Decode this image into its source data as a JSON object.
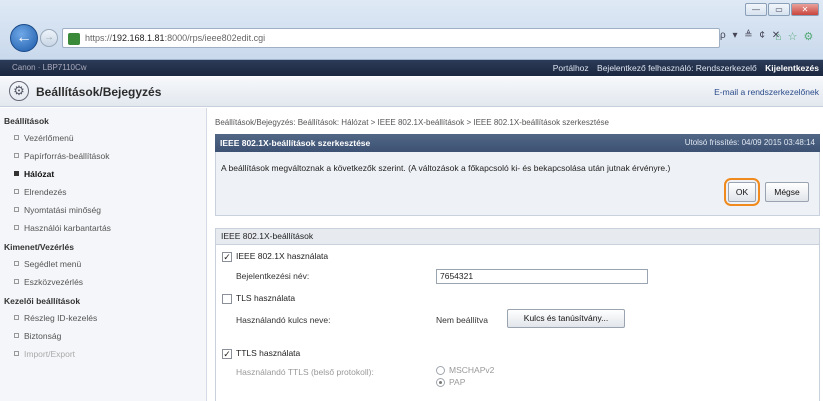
{
  "browser": {
    "url_prefix": "https://",
    "url_host": "192.168.1.81",
    "url_rest": ":8000/rps/ieee802edit.cgi",
    "search_tools": "ρ ▾ ≜ ¢ ✕",
    "window_minimize": "—",
    "window_maximize": "▭",
    "window_close": "✕"
  },
  "topbar": {
    "device_name": "Canon · LBP7110Cw",
    "links": [
      "Portálhoz",
      "Bejelentkező felhasználó: Rendszerkezelő"
    ],
    "logout": "Kijelentkezés"
  },
  "titlebar": {
    "title": "Beállítások/Bejegyzés",
    "mail_link": "E-mail a rendszerkezelőnek"
  },
  "sidebar": {
    "groups": [
      {
        "heading": "Beállítások",
        "items": [
          {
            "label": "Vezérlőmenü",
            "active": false
          },
          {
            "label": "Papírforrás-beállítások",
            "active": false
          },
          {
            "label": "Hálózat",
            "active": true
          },
          {
            "label": "Elrendezés",
            "active": false
          },
          {
            "label": "Nyomtatási minőség",
            "active": false
          },
          {
            "label": "Használói karbantartás",
            "active": false
          }
        ]
      },
      {
        "heading": "Kimenet/Vezérlés",
        "items": [
          {
            "label": "Segédlet menü",
            "active": false
          },
          {
            "label": "Eszközvezérlés",
            "active": false
          }
        ]
      },
      {
        "heading": "Kezelői beállítások",
        "items": [
          {
            "label": "Részleg ID-kezelés",
            "active": false
          },
          {
            "label": "Biztonság",
            "active": false
          },
          {
            "label": "Import/Export",
            "active": false
          }
        ]
      }
    ]
  },
  "content": {
    "breadcrumb": "Beállítások/Bejegyzés: Beállítások: Hálózat > IEEE 802.1X-beállítások > IEEE 802.1X-beállítások szerkesztése",
    "panel_title": "IEEE 802.1X-beállítások szerkesztése",
    "last_updated": "Utolsó frissítés: 04/09 2015 03:48:14",
    "message": "A beállítások megváltoznak a következők szerint. (A változások a főkapcsoló ki- és bekapcsolása után jutnak érvényre.)",
    "ok_label": "OK",
    "cancel_label": "Mégse",
    "section_title": "IEEE 802.1X-beállítások",
    "use_ieee": {
      "label": "IEEE 802.1X használata",
      "checked": true
    },
    "login_name_label": "Bejelentkezési név:",
    "login_name_value": "7654321",
    "use_tls": {
      "label": "TLS használata",
      "checked": false
    },
    "key_name_label": "Használandó kulcs neve:",
    "key_name_value": "Nem beállítva",
    "key_button": "Kulcs és tanúsítvány...",
    "use_ttls": {
      "label": "TTLS használata",
      "checked": true
    },
    "ttls_protocol_label": "Használandó TTLS (belső protokoll):",
    "ttls_options": [
      {
        "label": "MSCHAPv2",
        "selected": false
      },
      {
        "label": "PAP",
        "selected": true
      }
    ]
  }
}
